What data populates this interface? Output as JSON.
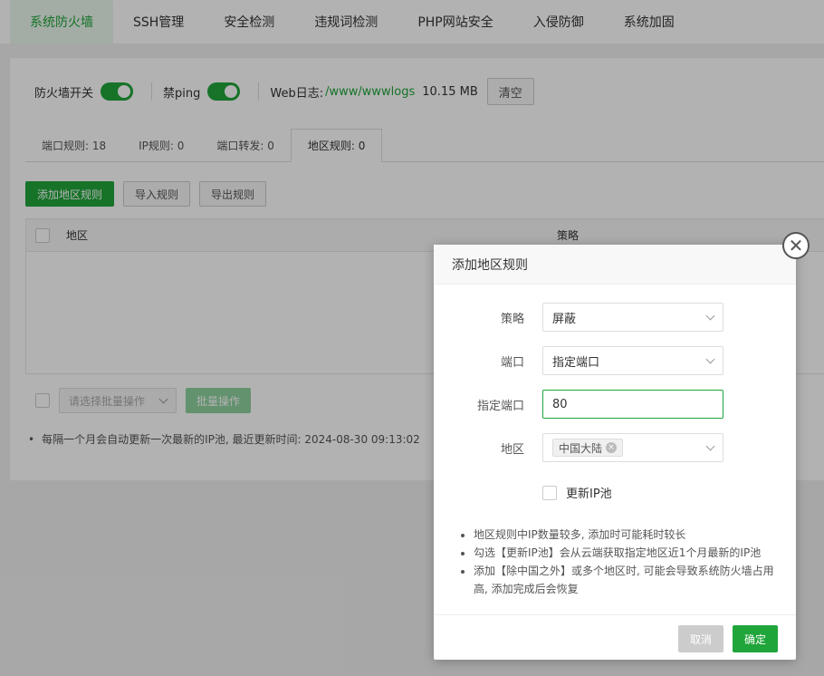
{
  "top_tabs": [
    "系统防火墙",
    "SSH管理",
    "安全检测",
    "违规词检测",
    "PHP网站安全",
    "入侵防御",
    "系统加固"
  ],
  "toolbar": {
    "firewall_label": "防火墙开关",
    "ping_label": "禁ping",
    "weblog_label": "Web日志:",
    "weblog_path": "/www/wwwlogs",
    "weblog_size": "10.15 MB",
    "clear_label": "清空"
  },
  "sub_tabs": [
    "端口规则: 18",
    "IP规则: 0",
    "端口转发: 0",
    "地区规则: 0"
  ],
  "actions": {
    "add": "添加地区规则",
    "import": "导入规则",
    "export": "导出规则"
  },
  "table": {
    "col_region": "地区",
    "col_strategy": "策略"
  },
  "batch": {
    "select_placeholder": "请选择批量操作",
    "batch_button": "批量操作"
  },
  "note": "每隔一个月会自动更新一次最新的IP池, 最近更新时间: 2024-08-30 09:13:02",
  "modal": {
    "title": "添加地区规则",
    "strategy_label": "策略",
    "strategy_value": "屏蔽",
    "port_label": "端口",
    "port_value": "指定端口",
    "specified_port_label": "指定端口",
    "specified_port_value": "80",
    "region_label": "地区",
    "region_tag": "中国大陆",
    "update_ip_label": "更新IP池",
    "tips": [
      "地区规则中IP数量较多, 添加时可能耗时较长",
      "勾选【更新IP池】会从云端获取指定地区近1个月最新的IP池",
      "添加【除中国之外】或多个地区时, 可能会导致系统防火墙占用高, 添加完成后会恢复"
    ],
    "cancel_label": "取消",
    "ok_label": "确定"
  },
  "colors": {
    "accent": "#20a53a"
  }
}
